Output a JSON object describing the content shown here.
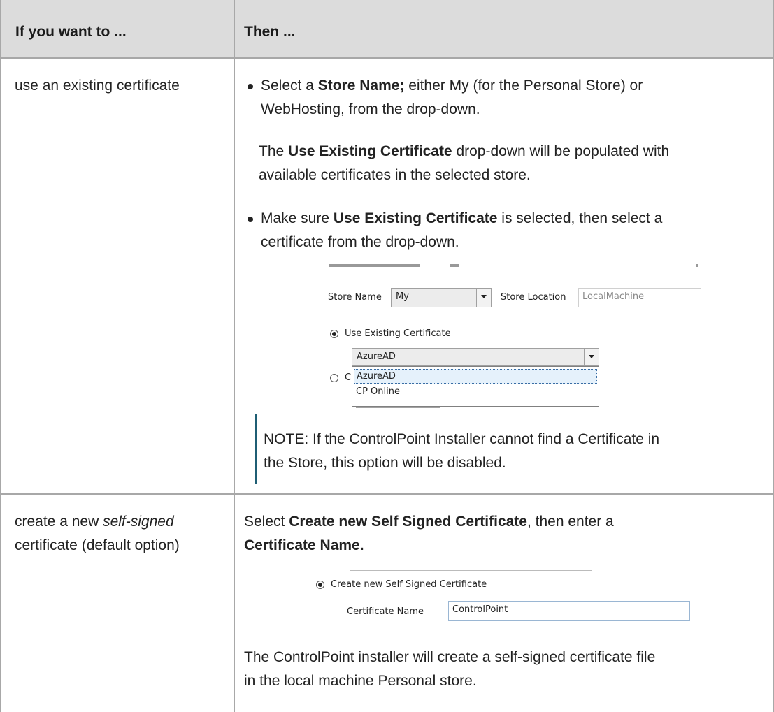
{
  "table": {
    "header": {
      "col1": "If you want to ...",
      "col2": "Then ..."
    },
    "row1": {
      "condition": "use an existing certificate",
      "bullet1": {
        "pre": "Select a ",
        "bold": "Store Name;",
        "post_line1": " either My (for the Personal Store) or",
        "line2": "WebHosting, from the drop-down."
      },
      "para": {
        "pre": "The ",
        "bold": "Use Existing Certificate",
        "post_line1": " drop-down will be populated with",
        "line2": "available certificates in the selected store."
      },
      "bullet2": {
        "pre": "Make sure ",
        "bold": "Use Existing Certificate",
        "post_line1": " is selected, then select a",
        "line2": "certificate from the drop-down."
      },
      "screenshot": {
        "store_name_label": "Store Name",
        "store_name_value": "My",
        "store_location_label": "Store Location",
        "store_location_value": "LocalMachine",
        "use_existing_label": "Use Existing Certificate",
        "cert_selected": "AzureAD",
        "other_radio_partial": "Cr",
        "dropdown_options": [
          "AzureAD",
          "CP Online"
        ]
      },
      "note": {
        "line1": "NOTE:  If the ControlPoint Installer cannot find a Certificate in",
        "line2": "the Store, this option will be disabled."
      }
    },
    "row2": {
      "condition_line1_pre": "create a new ",
      "condition_line1_italic": "self-signed",
      "condition_line2": "certificate (default option)",
      "instr": {
        "pre": "Select ",
        "bold1": "Create new Self Signed Certificate",
        "post": ", then enter a",
        "bold2": "Certificate Name."
      },
      "screenshot": {
        "radio_label": "Create new Self Signed Certificate",
        "cert_name_label": "Certificate Name",
        "cert_name_value": "ControlPoint"
      },
      "result": {
        "line1": "The ControlPoint installer will create a self-signed certificate file",
        "line2": "in the local machine Personal store."
      }
    }
  }
}
